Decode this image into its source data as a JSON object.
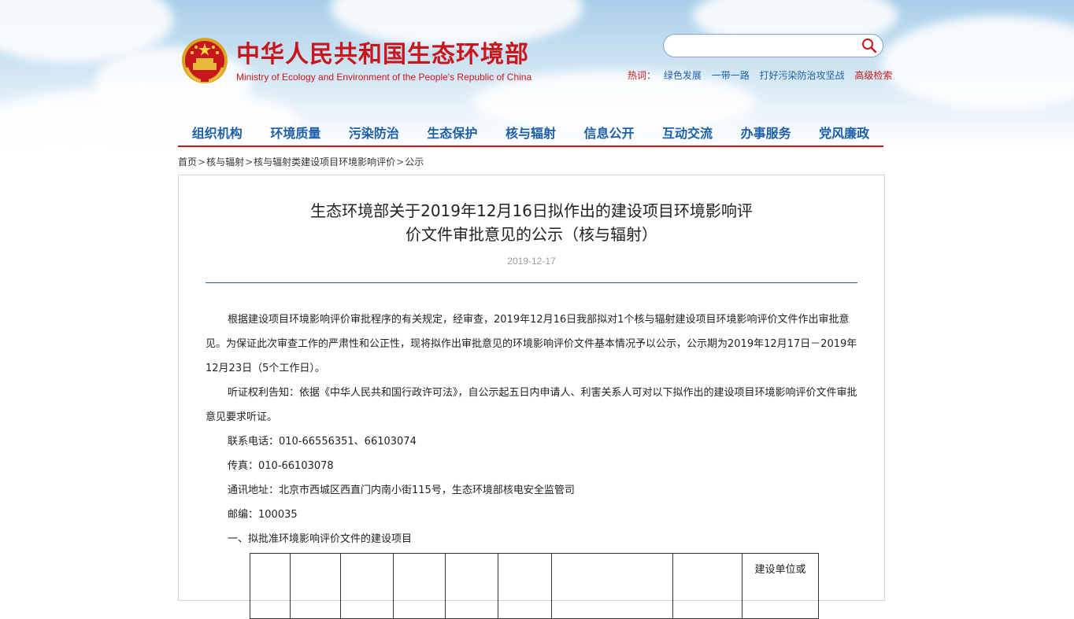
{
  "header": {
    "site_title": "中华人民共和国生态环境部",
    "site_subtitle": "Ministry of Ecology and Environment of the People's Republic of China",
    "search": {
      "placeholder": "",
      "icon": "search-icon"
    },
    "hot_label": "热词：",
    "hot_words": [
      "绿色发展",
      "一带一路",
      "打好污染防治攻坚战"
    ],
    "advanced_search": "高级检索",
    "brand_color": "#c8161d",
    "link_color": "#1c5fa8"
  },
  "nav": {
    "items": [
      "组织机构",
      "环境质量",
      "污染防治",
      "生态保护",
      "核与辐射",
      "信息公开",
      "互动交流",
      "办事服务",
      "党风廉政"
    ]
  },
  "breadcrumb": {
    "items": [
      "首页",
      "核与辐射",
      "核与辐射类建设项目环境影响评价",
      "公示"
    ],
    "separator": ">"
  },
  "article": {
    "title_line1": "生态环境部关于2019年12月16日拟作出的建设项目环境影响评",
    "title_line2": "价文件审批意见的公示（核与辐射）",
    "date": "2019-12-17",
    "paragraphs": [
      "根据建设项目环境影响评价审批程序的有关规定，经审查，2019年12月16日我部拟对1个核与辐射建设项目环境影响评价文件作出审批意见。为保证此次审查工作的严肃性和公正性，现将拟作出审批意见的环境影响评价文件基本情况予以公示，公示期为2019年12月17日－2019年12月23日（5个工作日）。",
      "听证权利告知：依据《中华人民共和国行政许可法》，自公示起五日内申请人、利害关系人可对以下拟作出的建设项目环境影响评价文件审批意见要求听证。",
      "联系电话：010-66556351、66103074",
      "传真：010-66103078",
      "通讯地址：北京市西城区西直门内南小街115号，生态环境部核电安全监管司",
      "邮编：100035",
      "一、拟批准环境影响评价文件的建设项目"
    ],
    "table_last_header": "建设单位或"
  }
}
